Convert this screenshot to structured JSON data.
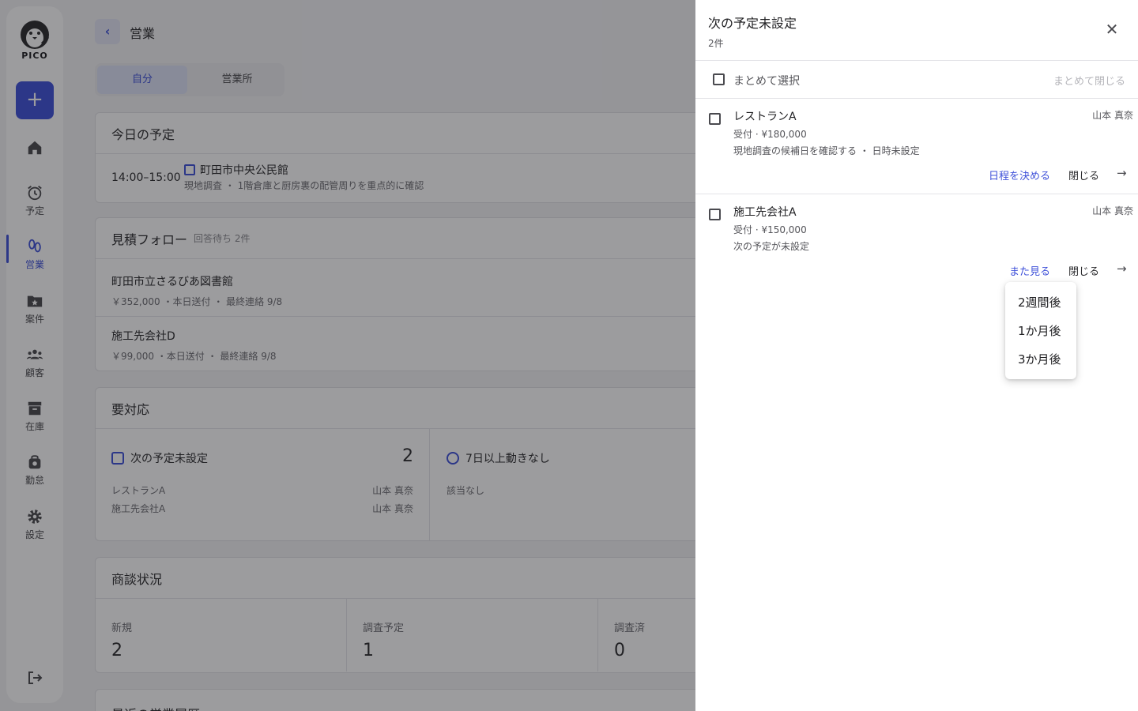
{
  "app": {
    "name": "PICO"
  },
  "sidebar": {
    "add_label": "+",
    "items": [
      {
        "label": "",
        "icon": "home-icon"
      },
      {
        "label": "予定",
        "icon": "alarm-clock-icon"
      },
      {
        "label": "営業",
        "icon": "footprints-icon"
      },
      {
        "label": "案件",
        "icon": "folder-star-icon"
      },
      {
        "label": "顧客",
        "icon": "people-icon"
      },
      {
        "label": "在庫",
        "icon": "archive-box-icon"
      },
      {
        "label": "勤怠",
        "icon": "bag-icon"
      },
      {
        "label": "設定",
        "icon": "gear-icon"
      }
    ]
  },
  "header": {
    "back": "‹",
    "title": "営業"
  },
  "segment": {
    "mine": "自分",
    "office": "営業所"
  },
  "today": {
    "title": "今日の予定",
    "time": "14:00–15:00",
    "place": "町田市中央公民館",
    "detail": "現地調査 ・ 1階倉庫と厨房裏の配管周りを重点的に確認"
  },
  "estimate": {
    "title": "見積フォロー",
    "sub": "回答待ち 2件",
    "items": [
      {
        "name": "町田市立さるびあ図書館",
        "meta": "￥352,000 ・本日送付 ・ 最終連絡 9/8"
      },
      {
        "name": "施工先会社D",
        "meta": "￥99,000 ・本日送付 ・ 最終連絡 9/8"
      }
    ]
  },
  "todo": {
    "title": "要対応",
    "unset": {
      "title": "次の予定未設定",
      "count": "2",
      "rows": [
        {
          "name": "レストランA",
          "owner": "山本 真奈"
        },
        {
          "name": "施工先会社A",
          "owner": "山本 真奈"
        }
      ]
    },
    "stale": {
      "title": "7日以上動きなし",
      "empty": "該当なし"
    }
  },
  "deals": {
    "title": "商談状況",
    "cells": [
      {
        "label": "新規",
        "value": "2"
      },
      {
        "label": "調査予定",
        "value": "1"
      },
      {
        "label": "調査済",
        "value": "0"
      }
    ]
  },
  "recent": {
    "title": "最近の営業履歴"
  },
  "drawer": {
    "title": "次の予定未設定",
    "count": "2件",
    "bulk_select": "まとめて選択",
    "bulk_close": "まとめて閉じる",
    "items": [
      {
        "name": "レストランA",
        "owner": "山本 真奈",
        "sub1": "受付 · ¥180,000",
        "sub2": "現地調査の候補日を確認する ・ 日時未設定",
        "action": "日程を決める",
        "close": "閉じる"
      },
      {
        "name": "施工先会社A",
        "owner": "山本 真奈",
        "sub1": "受付 · ¥150,000",
        "sub2": "次の予定が未設定",
        "action": "また見る",
        "close": "閉じる"
      }
    ]
  },
  "snooze_menu": {
    "options": [
      "2週間後",
      "1か月後",
      "3か月後"
    ]
  }
}
